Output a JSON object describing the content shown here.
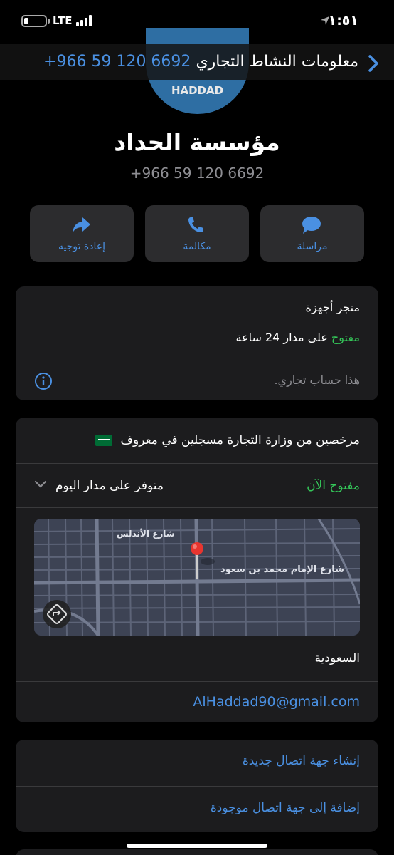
{
  "status_bar": {
    "time": "١:٥١",
    "carrier": "LTE",
    "location_icon": "location-arrow-icon",
    "battery_icon": "battery-low-icon",
    "signal_icon": "cellular-signal-icon"
  },
  "nav": {
    "phone": "+966 59 120 6692",
    "title": "معلومات النشاط التجاري",
    "back_icon": "chevron-right-icon"
  },
  "contact": {
    "avatar_text": "HADDAD",
    "name": "مؤسسة الحداد",
    "phone": "+966 59 120 6692"
  },
  "actions": [
    {
      "label": "مراسلة",
      "icon": "message-bubble-icon"
    },
    {
      "label": "مكالمة",
      "icon": "phone-icon"
    },
    {
      "label": "إعادة توجيه",
      "icon": "forward-arrow-icon"
    }
  ],
  "business_card": {
    "category": "متجر أجهزة",
    "open_label": "مفتوح",
    "hours_text": "على مدار 24 ساعة",
    "account_note": "هذا حساب تجاري.",
    "info_icon": "info-circle-icon"
  },
  "details_card": {
    "verified_text": "مرخصين من وزارة التجارة مسجلين في معروف",
    "flag_icon": "saudi-flag-icon",
    "open_now": "مفتوح الآن",
    "availability": "متوفر على مدار اليوم",
    "chevron_icon": "chevron-down-icon",
    "map": {
      "street_1": "شارع الأندلس",
      "street_2": "شارع الإمام محمد بن سعود",
      "pin_icon": "map-pin-icon",
      "directions_icon": "directions-icon"
    },
    "country": "السعودية",
    "email": "AlHaddad90@gmail.com"
  },
  "contact_actions": {
    "create_new": "إنشاء جهة اتصال جديدة",
    "add_existing": "إضافة إلى جهة اتصال موجودة"
  },
  "colors": {
    "accent": "#4a90e2",
    "green": "#34c759",
    "card": "#1c1c1e",
    "avatar": "#2e6ea3"
  }
}
